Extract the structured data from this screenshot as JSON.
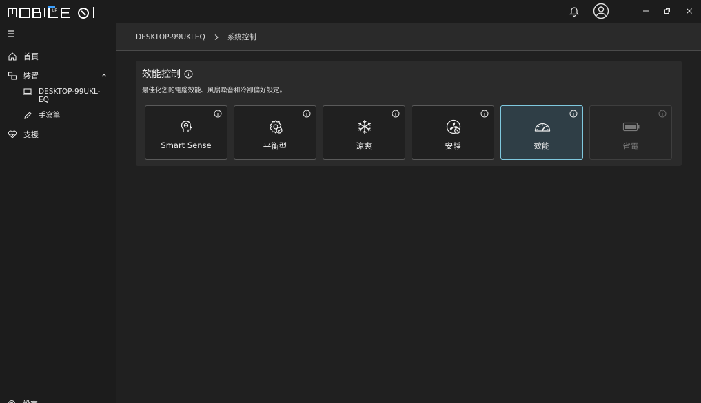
{
  "app": {
    "logo_text": "MOBILE01"
  },
  "titlebar": {
    "icons": [
      "bell-icon",
      "user-icon"
    ],
    "window_controls": [
      "minimize-icon",
      "restore-icon",
      "close-icon"
    ]
  },
  "sidebar": {
    "items": [
      {
        "label": "首頁",
        "icon": "home-icon"
      },
      {
        "label": "裝置",
        "icon": "devices-icon",
        "expanded": true
      },
      {
        "label": "DESKTOP-99UKL-EQ",
        "icon": "laptop-icon"
      },
      {
        "label": "手寫筆",
        "icon": "pen-icon"
      },
      {
        "label": "支援",
        "icon": "support-icon"
      }
    ],
    "bottom_label": "設定"
  },
  "breadcrumb": {
    "device": "DESKTOP-99UKLEQ",
    "current": "系統控制"
  },
  "panel": {
    "title": "效能控制",
    "description": "最佳化您的電腦效能、風扇噪音和冷卻偏好設定。",
    "modes": [
      {
        "label": "Smart Sense",
        "icon": "smart-sense-icon",
        "state": "normal"
      },
      {
        "label": "平衡型",
        "icon": "balanced-icon",
        "state": "normal"
      },
      {
        "label": "涼爽",
        "icon": "snowflake-icon",
        "state": "normal"
      },
      {
        "label": "安靜",
        "icon": "quiet-fan-icon",
        "state": "normal"
      },
      {
        "label": "效能",
        "icon": "gauge-icon",
        "state": "selected"
      },
      {
        "label": "省電",
        "icon": "battery-icon",
        "state": "disabled"
      }
    ]
  },
  "colors": {
    "background": "#202020",
    "sidebar": "#1c1c1c",
    "panel": "#2b2b2b",
    "selected_border": "#7fc8de",
    "selected_fill": "#2f3e46"
  }
}
